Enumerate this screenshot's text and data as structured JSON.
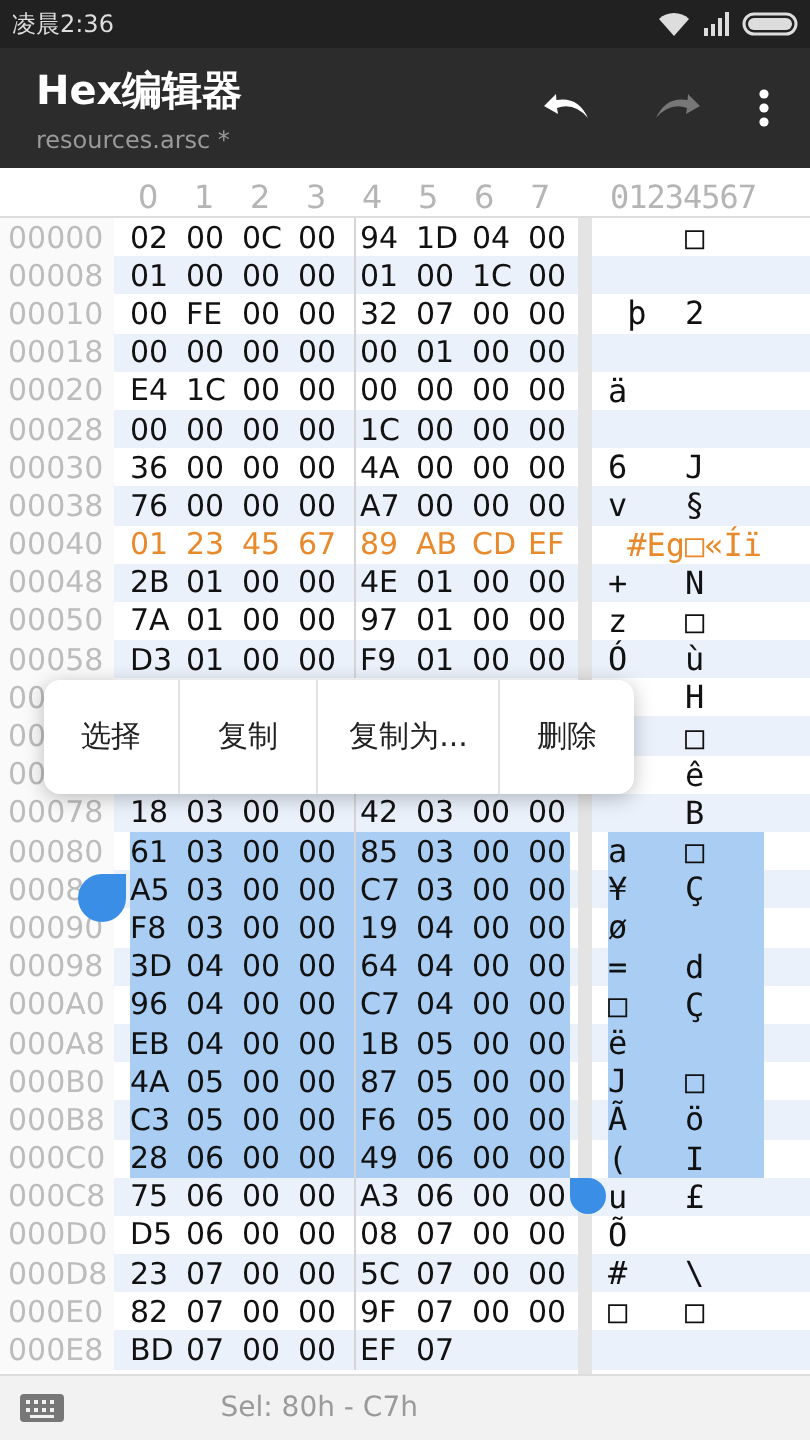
{
  "status_bar": {
    "time": "凌晨2:36"
  },
  "toolbar": {
    "title": "Hex编辑器",
    "subtitle": "resources.arsc *",
    "undo": {
      "disabled": false
    },
    "redo": {
      "disabled": true
    }
  },
  "column_header": {
    "hex": [
      "0",
      "1",
      "2",
      "3",
      "4",
      "5",
      "6",
      "7"
    ],
    "text": "01234567"
  },
  "rows": [
    {
      "address": "00000",
      "bytes": [
        "02",
        "00",
        "0C",
        "00",
        "94",
        "1D",
        "04",
        "00"
      ],
      "text": "    □",
      "highlighted": false,
      "selected": false
    },
    {
      "address": "00008",
      "bytes": [
        "01",
        "00",
        "00",
        "00",
        "01",
        "00",
        "1C",
        "00"
      ],
      "text": "",
      "highlighted": false,
      "selected": false
    },
    {
      "address": "00010",
      "bytes": [
        "00",
        "FE",
        "00",
        "00",
        "32",
        "07",
        "00",
        "00"
      ],
      "text": " þ  2",
      "highlighted": false,
      "selected": false
    },
    {
      "address": "00018",
      "bytes": [
        "00",
        "00",
        "00",
        "00",
        "00",
        "01",
        "00",
        "00"
      ],
      "text": "",
      "highlighted": false,
      "selected": false
    },
    {
      "address": "00020",
      "bytes": [
        "E4",
        "1C",
        "00",
        "00",
        "00",
        "00",
        "00",
        "00"
      ],
      "text": "ä",
      "highlighted": false,
      "selected": false
    },
    {
      "address": "00028",
      "bytes": [
        "00",
        "00",
        "00",
        "00",
        "1C",
        "00",
        "00",
        "00"
      ],
      "text": "",
      "highlighted": false,
      "selected": false
    },
    {
      "address": "00030",
      "bytes": [
        "36",
        "00",
        "00",
        "00",
        "4A",
        "00",
        "00",
        "00"
      ],
      "text": "6   J",
      "highlighted": false,
      "selected": false
    },
    {
      "address": "00038",
      "bytes": [
        "76",
        "00",
        "00",
        "00",
        "A7",
        "00",
        "00",
        "00"
      ],
      "text": "v   §",
      "highlighted": false,
      "selected": false
    },
    {
      "address": "00040",
      "bytes": [
        "01",
        "23",
        "45",
        "67",
        "89",
        "AB",
        "CD",
        "EF"
      ],
      "text": " #Eg□«Íï",
      "highlighted": true,
      "selected": false
    },
    {
      "address": "00048",
      "bytes": [
        "2B",
        "01",
        "00",
        "00",
        "4E",
        "01",
        "00",
        "00"
      ],
      "text": "+   N",
      "highlighted": false,
      "selected": false
    },
    {
      "address": "00050",
      "bytes": [
        "7A",
        "01",
        "00",
        "00",
        "97",
        "01",
        "00",
        "00"
      ],
      "text": "z   □",
      "highlighted": false,
      "selected": false
    },
    {
      "address": "00058",
      "bytes": [
        "D3",
        "01",
        "00",
        "00",
        "F9",
        "01",
        "00",
        "00"
      ],
      "text": "Ó   ù",
      "highlighted": false,
      "selected": false
    },
    {
      "address": "00",
      "bytes": [],
      "text": "    H",
      "highlighted": false,
      "selected": false
    },
    {
      "address": "00",
      "bytes": [],
      "text": "    □",
      "highlighted": false,
      "selected": false
    },
    {
      "address": "00",
      "bytes": [],
      "text": "    ê",
      "highlighted": false,
      "selected": false
    },
    {
      "address": "00078",
      "bytes": [
        "18",
        "03",
        "00",
        "00",
        "42",
        "03",
        "00",
        "00"
      ],
      "text": "    B",
      "highlighted": false,
      "selected": false
    },
    {
      "address": "00080",
      "bytes": [
        "61",
        "03",
        "00",
        "00",
        "85",
        "03",
        "00",
        "00"
      ],
      "text": "a   □",
      "highlighted": false,
      "selected": true
    },
    {
      "address": "0008",
      "bytes": [
        "A5",
        "03",
        "00",
        "00",
        "C7",
        "03",
        "00",
        "00"
      ],
      "text": "¥   Ç",
      "highlighted": false,
      "selected": true
    },
    {
      "address": "00090",
      "bytes": [
        "F8",
        "03",
        "00",
        "00",
        "19",
        "04",
        "00",
        "00"
      ],
      "text": "ø",
      "highlighted": false,
      "selected": true
    },
    {
      "address": "00098",
      "bytes": [
        "3D",
        "04",
        "00",
        "00",
        "64",
        "04",
        "00",
        "00"
      ],
      "text": "=   d",
      "highlighted": false,
      "selected": true
    },
    {
      "address": "000A0",
      "bytes": [
        "96",
        "04",
        "00",
        "00",
        "C7",
        "04",
        "00",
        "00"
      ],
      "text": "□   Ç",
      "highlighted": false,
      "selected": true
    },
    {
      "address": "000A8",
      "bytes": [
        "EB",
        "04",
        "00",
        "00",
        "1B",
        "05",
        "00",
        "00"
      ],
      "text": "ë",
      "highlighted": false,
      "selected": true
    },
    {
      "address": "000B0",
      "bytes": [
        "4A",
        "05",
        "00",
        "00",
        "87",
        "05",
        "00",
        "00"
      ],
      "text": "J   □",
      "highlighted": false,
      "selected": true
    },
    {
      "address": "000B8",
      "bytes": [
        "C3",
        "05",
        "00",
        "00",
        "F6",
        "05",
        "00",
        "00"
      ],
      "text": "Ã   ö",
      "highlighted": false,
      "selected": true
    },
    {
      "address": "000C0",
      "bytes": [
        "28",
        "06",
        "00",
        "00",
        "49",
        "06",
        "00",
        "00"
      ],
      "text": "(   I",
      "highlighted": false,
      "selected": true
    },
    {
      "address": "000C8",
      "bytes": [
        "75",
        "06",
        "00",
        "00",
        "A3",
        "06",
        "00",
        "00"
      ],
      "text": "u   £",
      "highlighted": false,
      "selected": false
    },
    {
      "address": "000D0",
      "bytes": [
        "D5",
        "06",
        "00",
        "00",
        "08",
        "07",
        "00",
        "00"
      ],
      "text": "Õ",
      "highlighted": false,
      "selected": false
    },
    {
      "address": "000D8",
      "bytes": [
        "23",
        "07",
        "00",
        "00",
        "5C",
        "07",
        "00",
        "00"
      ],
      "text": "#   \\",
      "highlighted": false,
      "selected": false
    },
    {
      "address": "000E0",
      "bytes": [
        "82",
        "07",
        "00",
        "00",
        "9F",
        "07",
        "00",
        "00"
      ],
      "text": "□   □",
      "highlighted": false,
      "selected": false
    },
    {
      "address": "000E8",
      "bytes": [
        "BD",
        "07",
        "00",
        "00",
        "EF",
        "07"
      ],
      "text": "",
      "highlighted": false,
      "selected": false
    }
  ],
  "context_menu": [
    "选择",
    "复制",
    "复制为...",
    "删除"
  ],
  "footer": {
    "selection": "Sel: 80h - C7h"
  }
}
